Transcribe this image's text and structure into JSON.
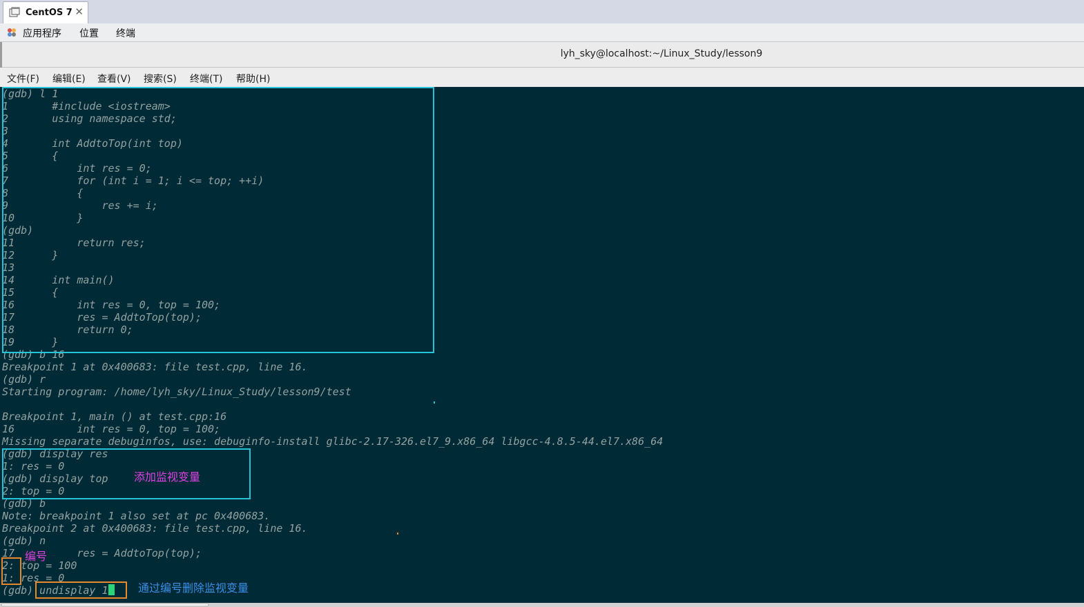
{
  "vm_tab": {
    "title": "CentOS 7",
    "close": "✕"
  },
  "gnome_topbar": {
    "items": [
      "应用程序",
      "位置",
      "终端"
    ]
  },
  "window": {
    "title": "lyh_sky@localhost:~/Linux_Study/lesson9"
  },
  "menubar": {
    "items": [
      "文件(F)",
      "编辑(E)",
      "查看(V)",
      "搜索(S)",
      "终端(T)",
      "帮助(H)"
    ]
  },
  "terminal": {
    "lines": [
      "(gdb) l 1",
      "1       #include <iostream>",
      "2       using namespace std;",
      "3",
      "4       int AddtoTop(int top)",
      "5       {",
      "6           int res = 0;",
      "7           for (int i = 1; i <= top; ++i)",
      "8           {",
      "9               res += i;",
      "10          }",
      "(gdb)",
      "11          return res;",
      "12      }",
      "13",
      "14      int main()",
      "15      {",
      "16          int res = 0, top = 100;",
      "17          res = AddtoTop(top);",
      "18          return 0;",
      "19      }",
      "(gdb) b 16",
      "Breakpoint 1 at 0x400683: file test.cpp, line 16.",
      "(gdb) r",
      "Starting program: /home/lyh_sky/Linux_Study/lesson9/test",
      "",
      "Breakpoint 1, main () at test.cpp:16",
      "16          int res = 0, top = 100;",
      "Missing separate debuginfos, use: debuginfo-install glibc-2.17-326.el7_9.x86_64 libgcc-4.8.5-44.el7.x86_64",
      "(gdb) display res",
      "1: res = 0",
      "(gdb) display top",
      "2: top = 0",
      "(gdb) b",
      "Note: breakpoint 1 also set at pc 0x400683.",
      "Breakpoint 2 at 0x400683: file test.cpp, line 16.",
      "(gdb) n",
      "17          res = AddtoTop(top);",
      "2: top = 100",
      "1: res = 0",
      "(gdb) undisplay 1"
    ]
  },
  "annotations": {
    "add_watch": "添加监视变量",
    "number": "编号",
    "delete_by_number": "通过编号删除监视变量"
  },
  "colors": {
    "terminal_bg": "#002b36",
    "terminal_fg": "#93a1a1",
    "box_cyan": "#25c4d8",
    "box_orange": "#e8892d",
    "note_magenta": "#e040e0",
    "note_blue": "#3a8ee6",
    "cursor": "#2bd67b"
  },
  "icons": {
    "vm_tab": "vm-window-icon",
    "apps": "apps-menu-icon"
  }
}
